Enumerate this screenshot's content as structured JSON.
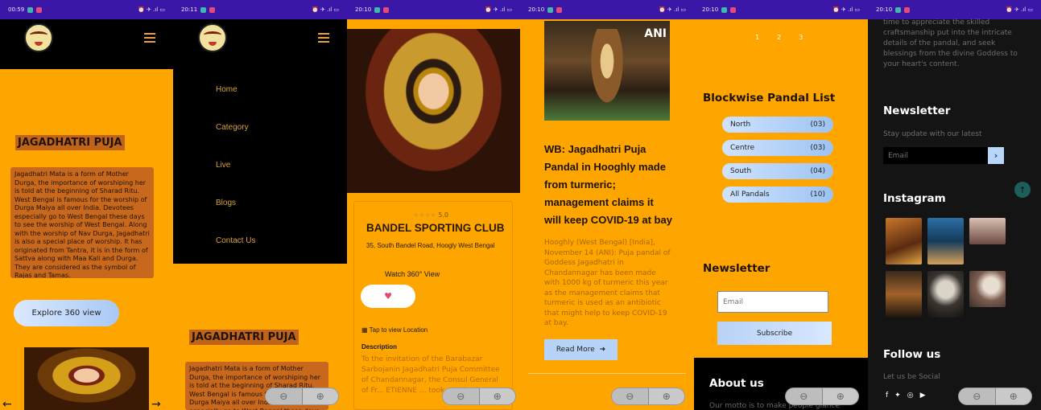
{
  "screens": [
    {
      "time": "00:59",
      "main": {
        "title": "JAGADHATRI PUJA",
        "paragraph": "Jagadhatri Mata is a form of Mother Durga, the importance of worshiping her is told at the beginning of Sharad Ritu. West Bengal is famous for the worship of Durga Maiya all over India. Devotees especially go to West Bengal these days to see the worship of West Bengal. Along with the worship of Nav Durga, Jagadhatri is also a special place of worship. It has originated from Tantra, it is in the form of Sattva along with Maa Kali and Durga. They are considered as the symbol of Rajas and Tamas.",
        "explore_button": "Explore 360 view"
      }
    },
    {
      "time": "20:11",
      "menu": [
        "Home",
        "Category",
        "Live",
        "Blogs",
        "Contact Us"
      ],
      "main": {
        "title": "JAGADHATRI PUJA",
        "paragraph": "Jagadhatri Mata is a form of Mother Durga, the importance of worshiping her is told at the beginning of Sharad Ritu. West Bengal is famous for the worship of Durga Maiya all over India. Devotees especially go to West Bengal these days to see the"
      }
    },
    {
      "time": "20:10",
      "rating": "5.0",
      "club_name": "BANDEL SPORTING CLUB",
      "address": "35, South Bandel Road, Hoogly West Bengal",
      "watch_label": "Watch 360° View",
      "tap_location": "Tap to view Location",
      "description_heading": "Description",
      "description": "To the invitation of the Barabazar Sarbojanin Jagadhatri Puja Committee of Chandannagar, the Consul General of Fr... ETIENNE ... took part in the"
    },
    {
      "time": "20:10",
      "watermark": "ANI",
      "headline": "WB: Jagadhatri Puja Pandal in Hooghly made from turmeric; management claims it will keep COVID-19 at bay",
      "body": "Hooghly (West Bengal) [India], November 14 (ANI): Puja pandal of Goddess Jagadhatri in Chandannagar has been made with 1000 kg of turmeric this year as the management claims that turmeric is used as an antibiotic that might help to keep COVID-19 at bay.",
      "read_more": "Read More"
    },
    {
      "time": "20:10",
      "pages": [
        "1",
        "2",
        "3"
      ],
      "blockwise_title": "Blockwise Pandal List",
      "blocks": [
        {
          "label": "North",
          "count": "(03)"
        },
        {
          "label": "Centre",
          "count": "(03)"
        },
        {
          "label": "South",
          "count": "(04)"
        },
        {
          "label": "All Pandals",
          "count": "(10)"
        }
      ],
      "newsletter_title": "Newsletter",
      "email_placeholder": "Email",
      "subscribe": "Subscribe",
      "about_title": "About us",
      "about_text": "Our motto is to make people glance"
    },
    {
      "time": "20:10",
      "top_text": "time to appreciate the skilled craftsmanship put into the intricate details of the pandal, and seek blessings from the divine Goddess to your heart's content.",
      "newsletter_title": "Newsletter",
      "newsletter_sub": "Stay update with our latest",
      "email_placeholder": "Email",
      "instagram_title": "Instagram",
      "follow_title": "Follow us",
      "follow_sub": "Let us be Social"
    }
  ],
  "colors": {
    "orange": "#fea500",
    "black": "#000000",
    "dark": "#141414",
    "status": "#3b17a8"
  }
}
